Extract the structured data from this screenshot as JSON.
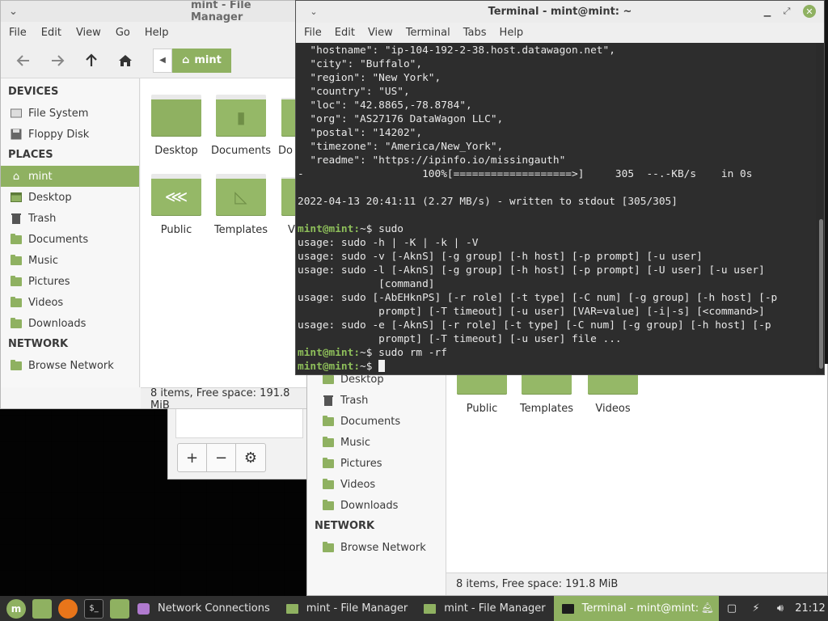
{
  "fm_back": {
    "title": "mint - File Manager",
    "menu": [
      "File",
      "Edit",
      "View",
      "Go",
      "Help"
    ],
    "path_crumb": "mint",
    "sidebar": {
      "devices_head": "DEVICES",
      "devices": [
        "File System",
        "Floppy Disk"
      ],
      "places_head": "PLACES",
      "places": [
        "mint",
        "Desktop",
        "Trash",
        "Documents",
        "Music",
        "Pictures",
        "Videos",
        "Downloads"
      ],
      "network_head": "NETWORK",
      "network": [
        "Browse Network"
      ]
    },
    "files": [
      "Desktop",
      "Documents",
      "Do",
      "Public",
      "Templates",
      "V"
    ],
    "status": "8 items, Free space: 191.8 MiB"
  },
  "fm_front": {
    "sidebar": [
      "Desktop",
      "Trash",
      "Documents",
      "Music",
      "Pictures",
      "Videos",
      "Downloads"
    ],
    "network_head": "NETWORK",
    "network": [
      "Browse Network"
    ],
    "files": [
      "Public",
      "Templates",
      "Videos"
    ],
    "status": "8 items, Free space: 191.8 MiB"
  },
  "dialog": {
    "buttons": [
      "+",
      "−",
      "⚙"
    ]
  },
  "terminal": {
    "title": "Terminal - mint@mint: ~",
    "menu": [
      "File",
      "Edit",
      "View",
      "Terminal",
      "Tabs",
      "Help"
    ],
    "lines": [
      "  \"hostname\": \"ip-104-192-2-38.host.datawagon.net\",",
      "  \"city\": \"Buffalo\",",
      "  \"region\": \"New York\",",
      "  \"country\": \"US\",",
      "  \"loc\": \"42.8865,-78.8784\",",
      "  \"org\": \"AS27176 DataWagon LLC\",",
      "  \"postal\": \"14202\",",
      "  \"timezone\": \"America/New_York\",",
      "  \"readme\": \"https://ipinfo.io/missingauth\"",
      "-                   100%[===================>]     305  --.-KB/s    in 0s",
      "",
      "2022-04-13 20:41:11 (2.27 MB/s) - written to stdout [305/305]",
      ""
    ],
    "prompt": "mint@mint:",
    "prompt_suffix": "~$ ",
    "cmd1": "sudo",
    "usage_lines": [
      "usage: sudo -h | -K | -k | -V",
      "usage: sudo -v [-AknS] [-g group] [-h host] [-p prompt] [-u user]",
      "usage: sudo -l [-AknS] [-g group] [-h host] [-p prompt] [-U user] [-u user]",
      "             [command]",
      "usage: sudo [-AbEHknPS] [-r role] [-t type] [-C num] [-g group] [-h host] [-p",
      "             prompt] [-T timeout] [-u user] [VAR=value] [-i|-s] [<command>]",
      "usage: sudo -e [-AknS] [-r role] [-t type] [-C num] [-g group] [-h host] [-p",
      "             prompt] [-T timeout] [-u user] file ..."
    ],
    "cmd2": "sudo rm -rf"
  },
  "taskbar": {
    "tasks": [
      "Network Connections",
      "mint - File Manager",
      "mint - File Manager",
      "Terminal - mint@mint: ~"
    ],
    "clock": "21:12"
  },
  "colors": {
    "accent": "#8fb161",
    "terminal_bg": "#2d2d2d",
    "prompt": "#8ebf5a"
  }
}
